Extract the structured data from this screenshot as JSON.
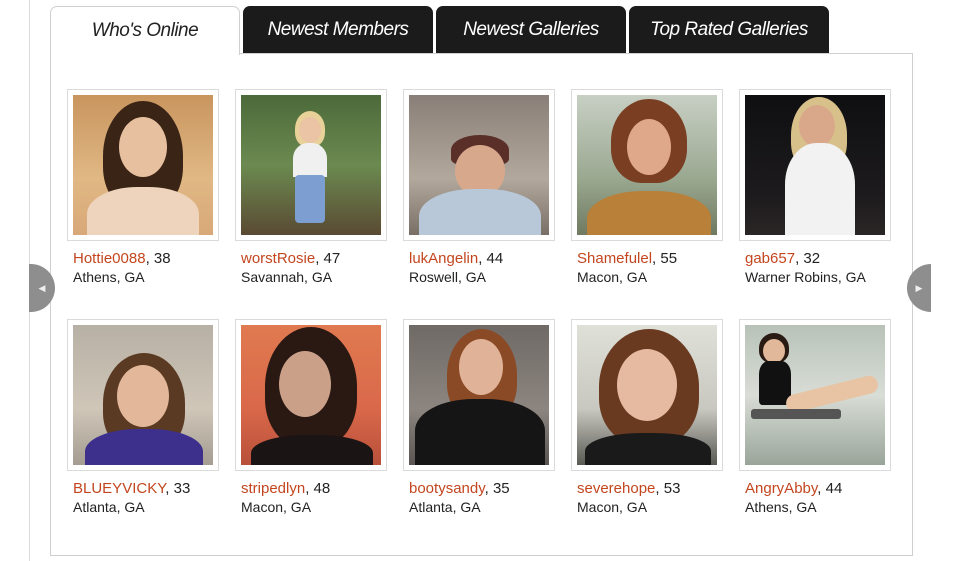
{
  "tabs": [
    {
      "label": "Who's Online",
      "active": true
    },
    {
      "label": "Newest Members",
      "active": false
    },
    {
      "label": "Newest Galleries",
      "active": false
    },
    {
      "label": "Top Rated Galleries",
      "active": false
    }
  ],
  "members": [
    {
      "username": "Hottie0088",
      "age": ", 38",
      "location": "Athens, GA"
    },
    {
      "username": "worstRosie",
      "age": ", 47",
      "location": "Savannah, GA"
    },
    {
      "username": "lukAngelin",
      "age": ", 44",
      "location": "Roswell, GA"
    },
    {
      "username": "Shamefulel",
      "age": ", 55",
      "location": "Macon, GA"
    },
    {
      "username": "gab657",
      "age": ", 32",
      "location": "Warner Robins, GA"
    },
    {
      "username": "BLUEYVICKY",
      "age": ", 33",
      "location": "Atlanta, GA"
    },
    {
      "username": "stripedlyn",
      "age": ", 48",
      "location": "Macon, GA"
    },
    {
      "username": "bootysandy",
      "age": ", 35",
      "location": "Atlanta, GA"
    },
    {
      "username": "severehope",
      "age": ", 53",
      "location": "Macon, GA"
    },
    {
      "username": "AngryAbby",
      "age": ", 44",
      "location": "Athens, GA"
    }
  ],
  "nav": {
    "prev_icon": "chevron-left-icon",
    "next_icon": "chevron-right-icon"
  },
  "colors": {
    "username": "#c3461f",
    "tab_dark": "#1b1b1b",
    "nav": "#8e8e8e"
  }
}
